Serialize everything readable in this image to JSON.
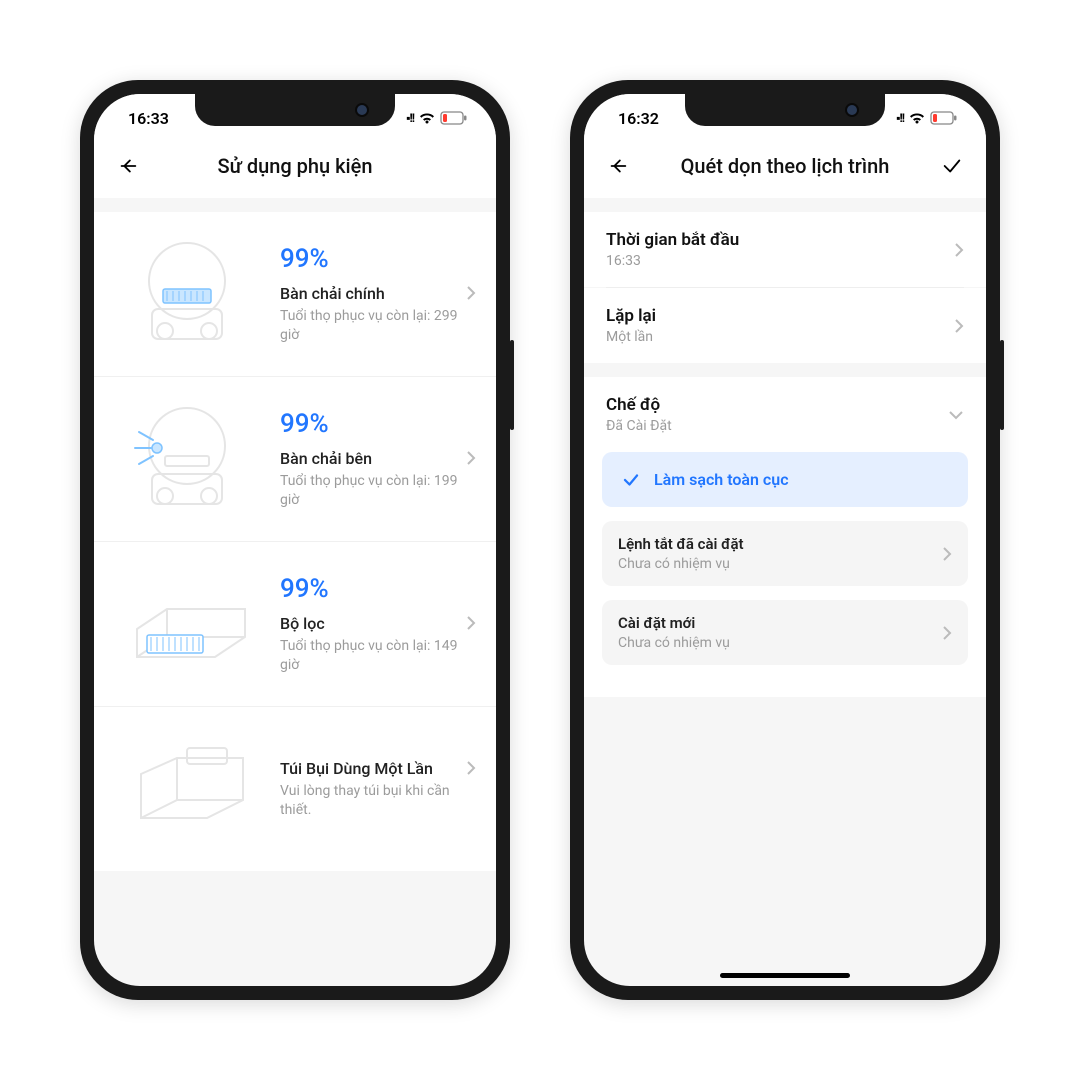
{
  "left": {
    "status_time": "16:33",
    "header_title": "Sử dụng phụ kiện",
    "items": [
      {
        "pct": "99%",
        "name": "Bàn chải chính",
        "sub": "Tuổi thọ phục vụ còn lại: 299 giờ"
      },
      {
        "pct": "99%",
        "name": "Bàn chải bên",
        "sub": "Tuổi thọ phục vụ còn lại: 199 giờ"
      },
      {
        "pct": "99%",
        "name": "Bộ lọc",
        "sub": "Tuổi thọ phục vụ còn lại: 149 giờ"
      },
      {
        "pct": "",
        "name": "Túi Bụi Dùng Một Lần",
        "sub": "Vui lòng thay túi bụi khi cần thiết."
      }
    ]
  },
  "right": {
    "status_time": "16:32",
    "header_title": "Quét dọn theo lịch trình",
    "start": {
      "title": "Thời gian bắt đầu",
      "value": "16:33"
    },
    "repeat": {
      "title": "Lặp lại",
      "value": "Một lần"
    },
    "mode": {
      "title": "Chế độ",
      "value": "Đã Cài Đặt"
    },
    "selected_option": "Làm sạch toàn cục",
    "cards": [
      {
        "title": "Lệnh tắt đã cài đặt",
        "sub": "Chưa có nhiệm vụ"
      },
      {
        "title": "Cài đặt mới",
        "sub": "Chưa có nhiệm vụ"
      }
    ]
  }
}
